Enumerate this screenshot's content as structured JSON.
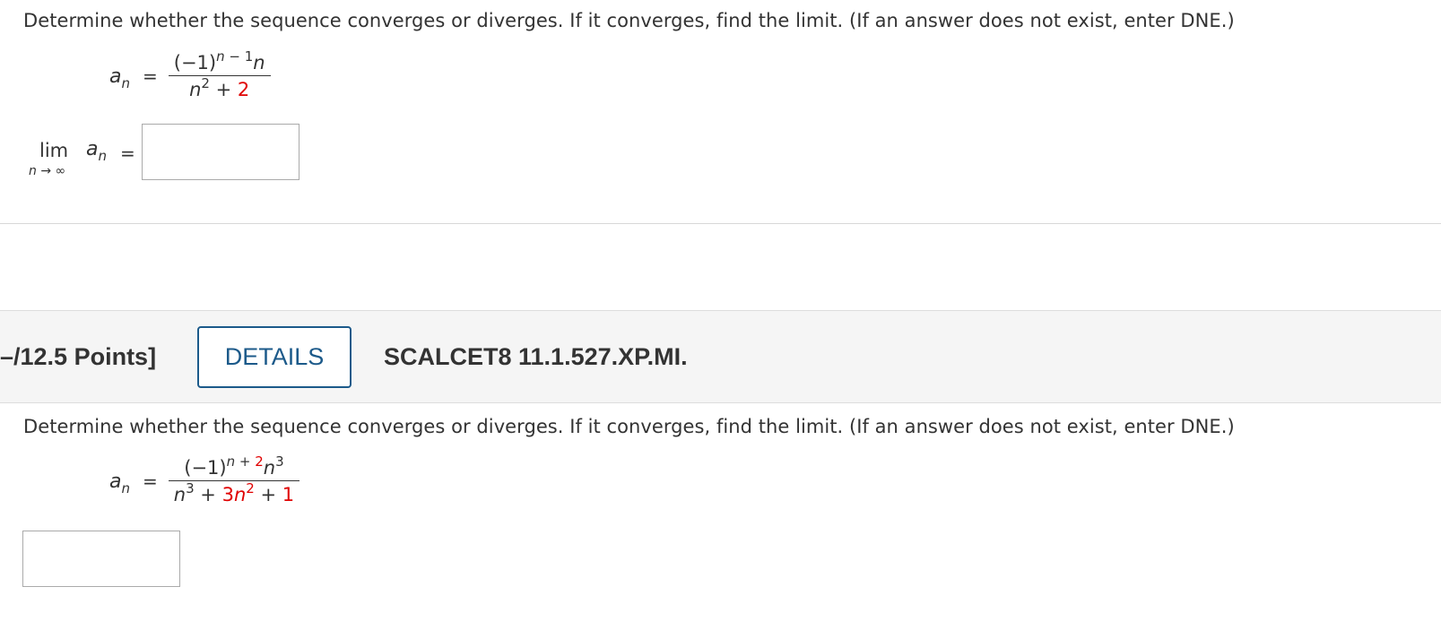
{
  "question1": {
    "instruction": "Determine whether the sequence converges or diverges. If it converges, find the limit. (If an answer does not exist, enter DNE.)",
    "formula": {
      "lhs_var": "a",
      "lhs_sub": "n",
      "equals": "=",
      "numerator": {
        "base": "(−1)",
        "exp_var": "n",
        "exp_rest": " − 1",
        "tail": "n"
      },
      "denominator": {
        "var": "n",
        "exp": "2",
        "plus": " + ",
        "const": "2"
      }
    },
    "limit": {
      "word": "lim",
      "sub": "n → ∞",
      "var": "a",
      "var_sub": "n",
      "equals": "="
    },
    "answer_value": ""
  },
  "question2_header": {
    "points": "–/12.5 Points]",
    "details_label": "DETAILS",
    "question_id": "SCALCET8 11.1.527.XP.MI."
  },
  "question2": {
    "instruction": "Determine whether the sequence converges or diverges. If it converges, find the limit. (If an answer does not exist, enter DNE.)",
    "formula": {
      "lhs_var": "a",
      "lhs_sub": "n",
      "equals": "=",
      "numerator": {
        "base": "(−1)",
        "exp_var": "n",
        "exp_plus": " + ",
        "exp_const": "2",
        "tail_var": "n",
        "tail_exp": "3"
      },
      "denominator": {
        "var": "n",
        "exp": "3",
        "plus1": " + ",
        "coef": "3",
        "var2": "n",
        "exp2": "2",
        "plus2": " + ",
        "const": "1"
      }
    },
    "answer_value": ""
  },
  "colors": {
    "accent": "#1c5a8a",
    "highlight_red": "#e00000",
    "text": "#333333",
    "header_bg": "#f5f5f5"
  }
}
